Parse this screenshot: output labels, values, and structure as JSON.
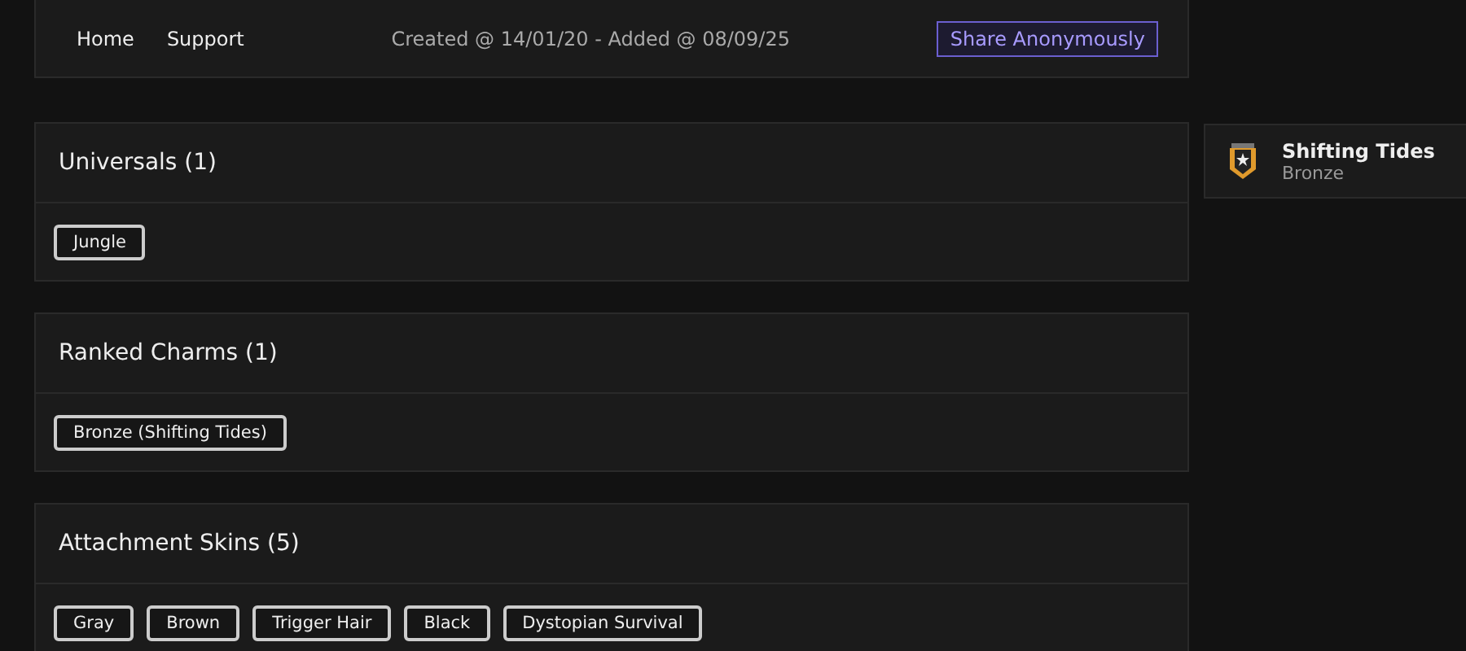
{
  "nav": {
    "links": [
      "Home",
      "Support"
    ],
    "info": "Created @ 14/01/20 - Added @ 08/09/25",
    "share_button": "Share Anonymously"
  },
  "sections": [
    {
      "title": "Universals (1)",
      "tags": [
        "Jungle"
      ]
    },
    {
      "title": "Ranked Charms (1)",
      "tags": [
        "Bronze (Shifting Tides)"
      ]
    },
    {
      "title": "Attachment Skins (5)",
      "tags": [
        "Gray",
        "Brown",
        "Trigger Hair",
        "Black",
        "Dystopian Survival"
      ]
    }
  ],
  "rank_card": {
    "name": "Shifting Tides",
    "tier": "Bronze"
  }
}
